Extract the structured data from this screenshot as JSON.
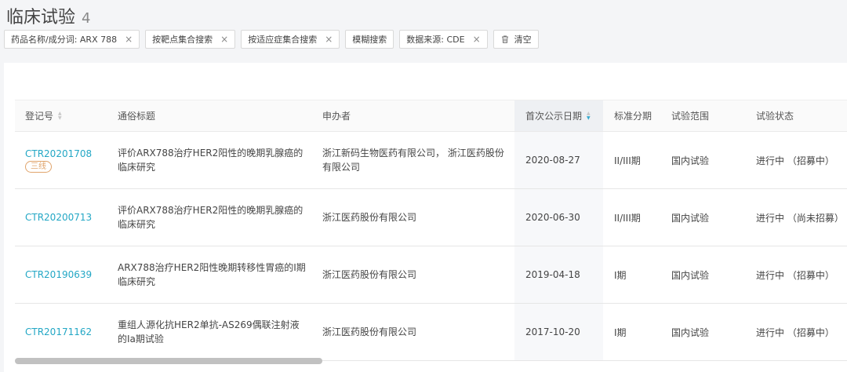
{
  "header": {
    "title": "临床试验",
    "count": "4"
  },
  "filters": [
    {
      "label": "药品名称/成分词: ARX 788",
      "closable": true
    },
    {
      "label": "按靶点集合搜索",
      "closable": true
    },
    {
      "label": "按适应症集合搜索",
      "closable": true
    },
    {
      "label": "模糊搜索",
      "closable": false
    },
    {
      "label": "数据来源: CDE",
      "closable": true
    }
  ],
  "clear_label": "清空",
  "close_glyph": "×",
  "table": {
    "columns": {
      "reg_no": "登记号",
      "title": "通俗标题",
      "sponsor": "申办者",
      "date": "首次公示日期",
      "phase": "标准分期",
      "scope": "试验范围",
      "status": "试验状态"
    },
    "rows": [
      {
        "reg_no": "CTR20201708",
        "badge": "三线",
        "title": "评价ARX788治疗HER2阳性的晚期乳腺癌的临床研究",
        "sponsor": "浙江新码生物医药有限公司， 浙江医药股份有限公司",
        "date": "2020-08-27",
        "phase": "II/III期",
        "scope": "国内试验",
        "status": "进行中 （招募中）"
      },
      {
        "reg_no": "CTR20200713",
        "badge": "",
        "title": "评价ARX788治疗HER2阳性的晚期乳腺癌的临床研究",
        "sponsor": "浙江医药股份有限公司",
        "date": "2020-06-30",
        "phase": "II/III期",
        "scope": "国内试验",
        "status": "进行中 （尚未招募）"
      },
      {
        "reg_no": "CTR20190639",
        "badge": "",
        "title": "ARX788治疗HER2阳性晚期转移性胃癌的I期临床研究",
        "sponsor": "浙江医药股份有限公司",
        "date": "2019-04-18",
        "phase": "I期",
        "scope": "国内试验",
        "status": "进行中 （招募中）"
      },
      {
        "reg_no": "CTR20171162",
        "badge": "",
        "title": "重组人源化抗HER2单抗-AS269偶联注射液的Ia期试验",
        "sponsor": "浙江医药股份有限公司",
        "date": "2017-10-20",
        "phase": "I期",
        "scope": "国内试验",
        "status": "进行中 （招募中）"
      }
    ]
  },
  "colors": {
    "link": "#23a7c5",
    "badge": "#e0a46b",
    "sort_active": "#36a9ce"
  },
  "icons": {
    "sort": "sort-icon",
    "clear": "trash-icon",
    "close": "close-icon"
  }
}
